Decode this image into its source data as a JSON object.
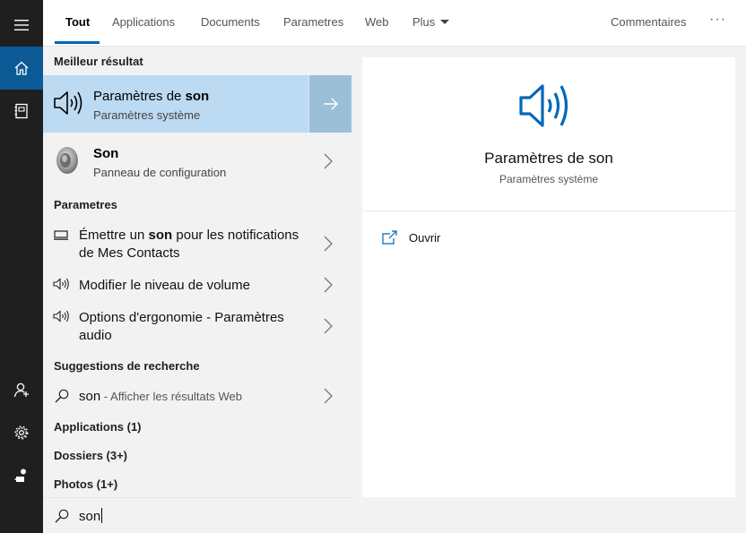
{
  "tabs": [
    "Tout",
    "Applications",
    "Documents",
    "Parametres",
    "Web",
    "Plus"
  ],
  "feedback": "Commentaires",
  "more_dots": "···",
  "sections": {
    "best": "Meilleur résultat",
    "settings": "Parametres",
    "suggestions": "Suggestions de recherche"
  },
  "best_match": {
    "title_prefix": "Paramètres de ",
    "title_bold": "son",
    "subtitle": "Paramètres système"
  },
  "control_panel": {
    "title": "Son",
    "subtitle": "Panneau de configuration"
  },
  "settings_items": [
    {
      "pre": "Émettre un ",
      "bold": "son",
      "post": " pour les notifications de Mes Contacts"
    },
    {
      "pre": "Modifier le niveau de volume",
      "bold": "",
      "post": ""
    },
    {
      "pre": "Options d'ergonomie - Paramètres audio",
      "bold": "",
      "post": ""
    }
  ],
  "suggestion": {
    "term": "son",
    "hint": " - Afficher les résultats Web"
  },
  "categories": [
    "Applications (1)",
    "Dossiers (3+)",
    "Photos (1+)"
  ],
  "search": {
    "query": "son"
  },
  "preview": {
    "title": "Paramètres de son",
    "subtitle": "Paramètres système",
    "open_label": "Ouvrir"
  },
  "colors": {
    "accent": "#0067b8",
    "selected_bg": "#bcdaf2",
    "rail_bg": "#1f1f1f",
    "rail_active": "#0b5a96"
  },
  "icons": {
    "rail": [
      "hamburger-icon",
      "home-icon",
      "notebook-icon",
      "person-icon",
      "gear-icon",
      "feedback-icon"
    ],
    "best_match": "speaker-icon",
    "control_panel": "speaker-3d-icon",
    "settings": [
      "monitor-icon",
      "speaker-icon",
      "speaker-icon"
    ],
    "search": "search-icon",
    "open": "open-external-icon"
  }
}
